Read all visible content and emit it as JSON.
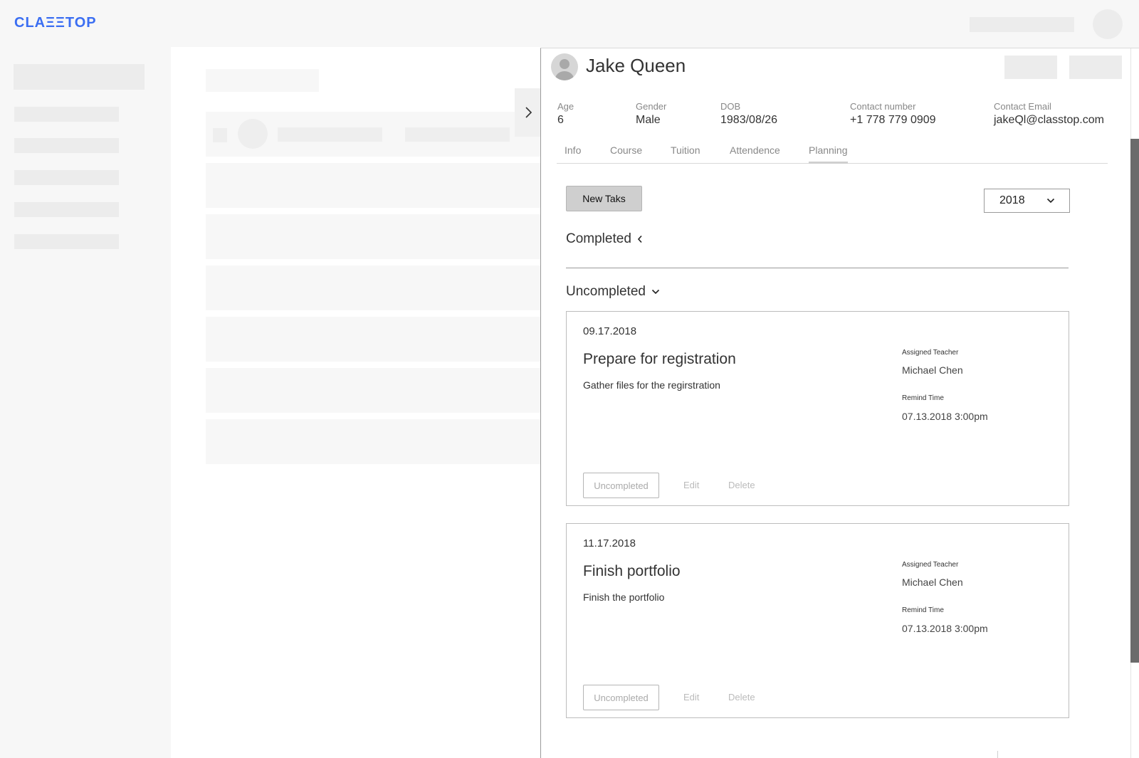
{
  "app": {
    "logo": "CLAΞΞTOP"
  },
  "student": {
    "name": "Jake Queen",
    "fields": [
      {
        "label": "Age",
        "value": "6"
      },
      {
        "label": "Gender",
        "value": "Male"
      },
      {
        "label": "DOB",
        "value": "1983/08/26"
      },
      {
        "label": "Contact number",
        "value": "+1 778 779 0909"
      },
      {
        "label": "Contact Email",
        "value": "jakeQl@classtop.com"
      }
    ]
  },
  "tabs": [
    {
      "label": "Info"
    },
    {
      "label": "Course"
    },
    {
      "label": "Tuition"
    },
    {
      "label": "Attendence"
    },
    {
      "label": "Planning",
      "active": true
    }
  ],
  "planning": {
    "new_task_label": "New Taks",
    "year": "2018",
    "completed_label": "Completed",
    "uncompleted_label": "Uncompleted",
    "tasks": [
      {
        "date": "09.17.2018",
        "title": "Prepare for registration",
        "description": "Gather files for the regirstration",
        "teacher_label": "Assigned Teacher",
        "teacher": "Michael Chen",
        "remind_label": "Remind Time",
        "remind_time": "07.13.2018 3:00pm",
        "status_label": "Uncompleted",
        "edit_label": "Edit",
        "delete_label": "Delete"
      },
      {
        "date": "11.17.2018",
        "title": "Finish portfolio",
        "description": "Finish the portfolio",
        "teacher_label": "Assigned Teacher",
        "teacher": "Michael Chen",
        "remind_label": "Remind Time",
        "remind_time": "07.13.2018 3:00pm",
        "status_label": "Uncompleted",
        "edit_label": "Edit",
        "delete_label": "Delete"
      }
    ]
  },
  "icons": {
    "expand": "chevron-right-icon",
    "completed_toggle": "chevron-left-icon",
    "uncompleted_toggle": "chevron-down-icon",
    "year_dropdown": "chevron-down-icon",
    "avatar": "user-icon"
  },
  "colors": {
    "brand": "#3b6ef2",
    "skeleton": "#ececec",
    "scrollbar": "#6b6b6b"
  }
}
